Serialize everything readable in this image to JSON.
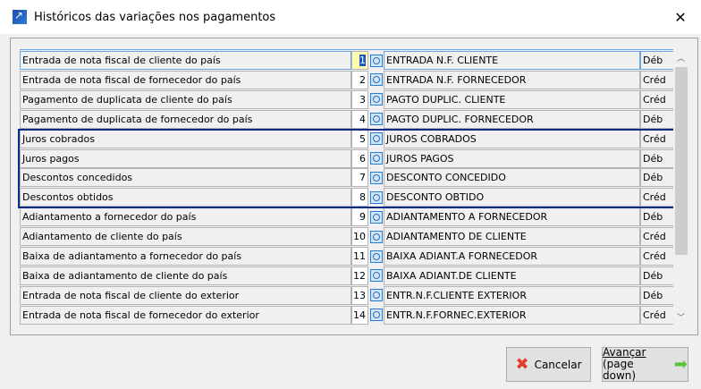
{
  "window": {
    "title": "Históricos das variações nos pagamentos",
    "close": "✕"
  },
  "rows": [
    {
      "desc": "Entrada de nota fiscal de cliente do país",
      "num": "1",
      "code": "ENTRADA N.F. CLIENTE",
      "type": "Déb"
    },
    {
      "desc": "Entrada de nota fiscal de fornecedor do país",
      "num": "2",
      "code": "ENTRADA N.F. FORNECEDOR",
      "type": "Créd"
    },
    {
      "desc": "Pagamento de duplicata de cliente do país",
      "num": "3",
      "code": "PAGTO DUPLIC. CLIENTE",
      "type": "Créd"
    },
    {
      "desc": "Pagamento de duplicata de fornecedor do país",
      "num": "4",
      "code": "PAGTO DUPLIC. FORNECEDOR",
      "type": "Déb"
    },
    {
      "desc": "Juros cobrados",
      "num": "5",
      "code": "JUROS COBRADOS",
      "type": "Créd"
    },
    {
      "desc": "Juros pagos",
      "num": "6",
      "code": "JUROS PAGOS",
      "type": "Déb"
    },
    {
      "desc": "Descontos concedidos",
      "num": "7",
      "code": "DESCONTO CONCEDIDO",
      "type": "Déb"
    },
    {
      "desc": "Descontos obtidos",
      "num": "8",
      "code": "DESCONTO OBTIDO",
      "type": "Créd"
    },
    {
      "desc": "Adiantamento a fornecedor do país",
      "num": "9",
      "code": "ADIANTAMENTO A FORNECEDOR",
      "type": "Déb"
    },
    {
      "desc": "Adiantamento de cliente do país",
      "num": "10",
      "code": "ADIANTAMENTO DE CLIENTE",
      "type": "Créd"
    },
    {
      "desc": "Baixa de adiantamento a fornecedor do país",
      "num": "11",
      "code": "BAIXA ADIANT.A FORNECEDOR",
      "type": "Créd"
    },
    {
      "desc": "Baixa de adiantamento de cliente do país",
      "num": "12",
      "code": "BAIXA ADIANT.DE CLIENTE",
      "type": "Déb"
    },
    {
      "desc": "Entrada de nota fiscal de cliente do exterior",
      "num": "13",
      "code": "ENTR.N.F.CLIENTE EXTERIOR",
      "type": "Déb"
    },
    {
      "desc": "Entrada de nota fiscal de fornecedor do exterior",
      "num": "14",
      "code": "ENTR.N.F.FORNEC.EXTERIOR",
      "type": "Créd"
    }
  ],
  "buttons": {
    "cancel": "Cancelar",
    "next_line1": "Avançar",
    "next_line2": "(page down)"
  }
}
